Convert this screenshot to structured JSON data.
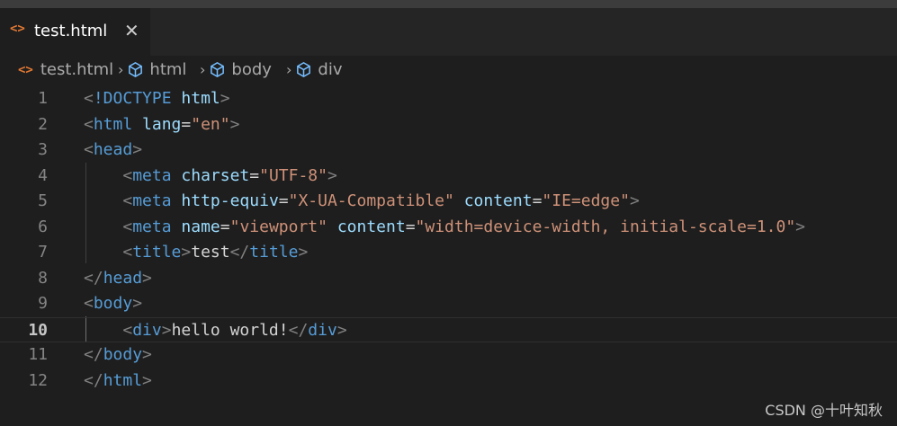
{
  "tab": {
    "icon": "<>",
    "title": "test.html",
    "close": "✕"
  },
  "breadcrumb": {
    "file_icon": "<>",
    "items": [
      "test.html",
      "html",
      "body",
      "div"
    ],
    "separator": "›"
  },
  "editor": {
    "current_line": 10,
    "lines": [
      {
        "n": "1",
        "tokens": [
          [
            "p",
            "<"
          ],
          [
            "t",
            "!DOCTYPE"
          ],
          [
            "txt",
            " "
          ],
          [
            "a",
            "html"
          ],
          [
            "p",
            ">"
          ]
        ]
      },
      {
        "n": "2",
        "tokens": [
          [
            "p",
            "<"
          ],
          [
            "t",
            "html"
          ],
          [
            "txt",
            " "
          ],
          [
            "a",
            "lang"
          ],
          [
            "txt",
            "="
          ],
          [
            "s",
            "\"en\""
          ],
          [
            "p",
            ">"
          ]
        ]
      },
      {
        "n": "3",
        "tokens": [
          [
            "p",
            "<"
          ],
          [
            "t",
            "head"
          ],
          [
            "p",
            ">"
          ]
        ]
      },
      {
        "n": "4",
        "tokens": [
          [
            "txt",
            "    "
          ],
          [
            "p",
            "<"
          ],
          [
            "t",
            "meta"
          ],
          [
            "txt",
            " "
          ],
          [
            "a",
            "charset"
          ],
          [
            "txt",
            "="
          ],
          [
            "s",
            "\"UTF-8\""
          ],
          [
            "p",
            ">"
          ]
        ]
      },
      {
        "n": "5",
        "tokens": [
          [
            "txt",
            "    "
          ],
          [
            "p",
            "<"
          ],
          [
            "t",
            "meta"
          ],
          [
            "txt",
            " "
          ],
          [
            "a",
            "http-equiv"
          ],
          [
            "txt",
            "="
          ],
          [
            "s",
            "\"X-UA-Compatible\""
          ],
          [
            "txt",
            " "
          ],
          [
            "a",
            "content"
          ],
          [
            "txt",
            "="
          ],
          [
            "s",
            "\"IE=edge\""
          ],
          [
            "p",
            ">"
          ]
        ]
      },
      {
        "n": "6",
        "tokens": [
          [
            "txt",
            "    "
          ],
          [
            "p",
            "<"
          ],
          [
            "t",
            "meta"
          ],
          [
            "txt",
            " "
          ],
          [
            "a",
            "name"
          ],
          [
            "txt",
            "="
          ],
          [
            "s",
            "\"viewport\""
          ],
          [
            "txt",
            " "
          ],
          [
            "a",
            "content"
          ],
          [
            "txt",
            "="
          ],
          [
            "s",
            "\"width=device-width, initial-scale=1.0\""
          ],
          [
            "p",
            ">"
          ]
        ]
      },
      {
        "n": "7",
        "tokens": [
          [
            "txt",
            "    "
          ],
          [
            "p",
            "<"
          ],
          [
            "t",
            "title"
          ],
          [
            "p",
            ">"
          ],
          [
            "txt",
            "test"
          ],
          [
            "p",
            "</"
          ],
          [
            "t",
            "title"
          ],
          [
            "p",
            ">"
          ]
        ]
      },
      {
        "n": "8",
        "tokens": [
          [
            "p",
            "</"
          ],
          [
            "t",
            "head"
          ],
          [
            "p",
            ">"
          ]
        ]
      },
      {
        "n": "9",
        "tokens": [
          [
            "p",
            "<"
          ],
          [
            "t",
            "body"
          ],
          [
            "p",
            ">"
          ]
        ]
      },
      {
        "n": "10",
        "tokens": [
          [
            "txt",
            "    "
          ],
          [
            "p",
            "<"
          ],
          [
            "t",
            "div"
          ],
          [
            "p",
            ">"
          ],
          [
            "txt",
            "hello world!"
          ],
          [
            "p",
            "</"
          ],
          [
            "t",
            "div"
          ],
          [
            "p",
            ">"
          ]
        ]
      },
      {
        "n": "11",
        "tokens": [
          [
            "p",
            "</"
          ],
          [
            "t",
            "body"
          ],
          [
            "p",
            ">"
          ]
        ]
      },
      {
        "n": "12",
        "tokens": [
          [
            "p",
            "</"
          ],
          [
            "t",
            "html"
          ],
          [
            "p",
            ">"
          ]
        ]
      }
    ]
  },
  "watermark": "CSDN @十叶知秋",
  "colors": {
    "background": "#1e1e1e",
    "tag": "#569cd6",
    "attribute": "#9cdcfe",
    "string": "#ce9178",
    "punctuation": "#808080",
    "file_icon": "#e37933"
  }
}
